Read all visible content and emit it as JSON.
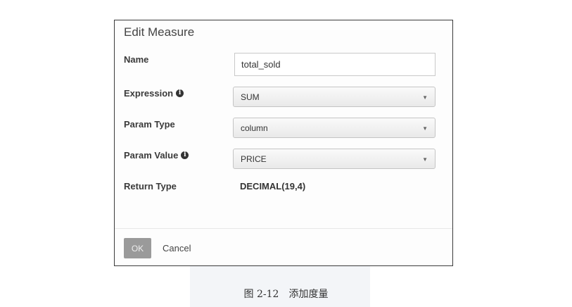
{
  "dialog": {
    "title": "Edit Measure",
    "name": {
      "label": "Name",
      "value": "total_sold"
    },
    "expression": {
      "label": "Expression",
      "info_icon": "info-icon",
      "selected": "SUM"
    },
    "param_type": {
      "label": "Param Type",
      "selected": "column"
    },
    "param_value": {
      "label": "Param Value",
      "info_icon": "info-icon",
      "selected": "PRICE"
    },
    "return_type": {
      "label": "Return Type",
      "value": "DECIMAL(19,4)"
    },
    "buttons": {
      "ok": "OK",
      "cancel": "Cancel"
    }
  },
  "caption": "图 2-12　添加度量"
}
